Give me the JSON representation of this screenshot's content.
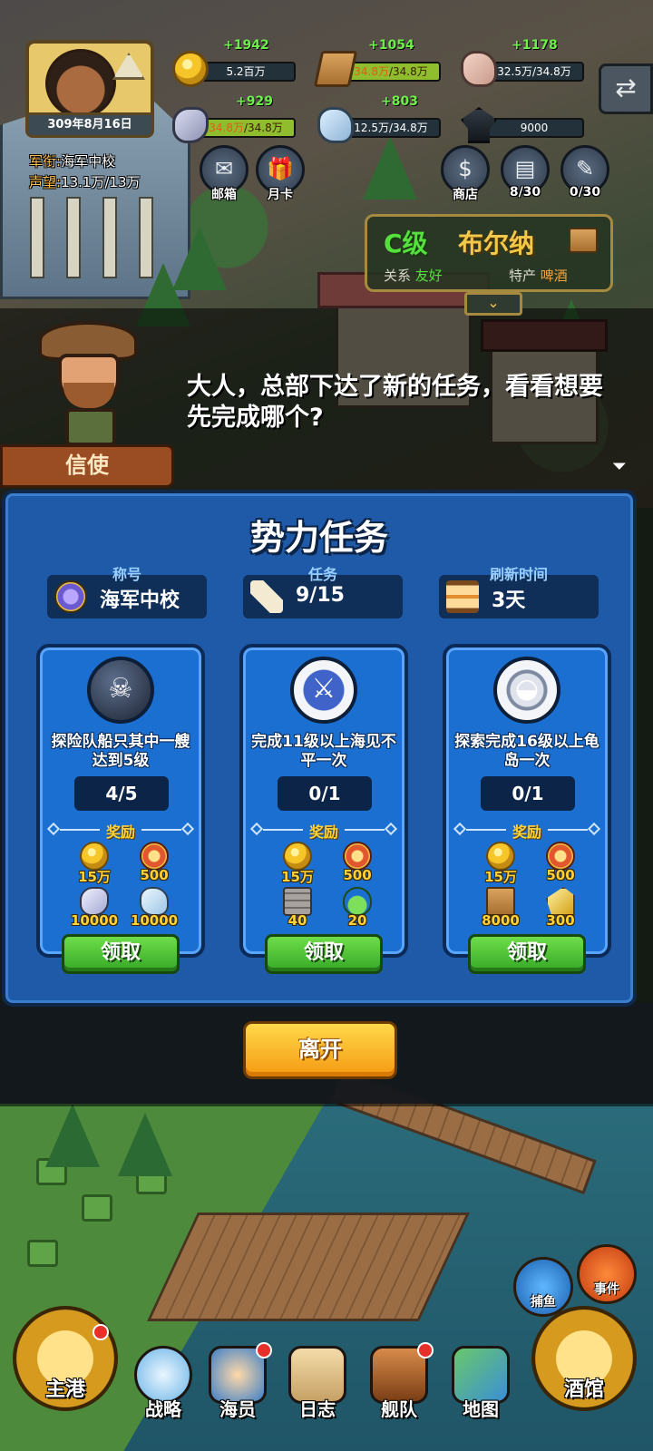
{
  "player": {
    "date": "309年8月16日",
    "rank_key": "军衔:",
    "rank_val": "海军中校",
    "prestige_key": "声望:",
    "prestige_val": "13.1万/13万"
  },
  "resources": [
    {
      "name": "gold",
      "icon": "coin-icon",
      "gain": "+1942",
      "amount": "5.2百万",
      "capped": false
    },
    {
      "name": "wood",
      "icon": "wood-icon",
      "gain": "+1054",
      "amount": "34.8万",
      "cap": "/34.8万",
      "capped": true
    },
    {
      "name": "stone",
      "icon": "stone-icon",
      "gain": "+1178",
      "amount": "32.5万/34.8万",
      "capped": false
    },
    {
      "name": "iron",
      "icon": "iron-ore-icon",
      "gain": "+929",
      "amount": "34.8万",
      "cap": "/34.8万",
      "capped": true
    },
    {
      "name": "crystal",
      "icon": "crystal-icon",
      "gain": "+803",
      "amount": "12.5万/34.8万",
      "capped": false
    },
    {
      "name": "knowledge",
      "icon": "graduation-cap-icon",
      "gain": "",
      "amount": "9000",
      "capped": false
    }
  ],
  "hud_buttons": {
    "mail": "邮箱",
    "monthly_card": "月卡",
    "shop": "商店",
    "book": "8/30",
    "scroll": "0/30"
  },
  "town": {
    "grade": "C级",
    "name": "布尔纳",
    "relation_key": "关系",
    "relation_val": "友好",
    "product_key": "特产",
    "product_val": "啤酒"
  },
  "dialogue": {
    "speaker": "信使",
    "text": "大人，总部下达了新的任务，看看想要先完成哪个?"
  },
  "panel": {
    "title": "势力任务",
    "info": [
      {
        "caption": "称号",
        "value": "海军中校",
        "icon": "rank-medal-icon"
      },
      {
        "caption": "任务",
        "value": "9/15",
        "icon": "scroll-icon"
      },
      {
        "caption": "刷新时间",
        "value": "3天",
        "icon": "hourglass-icon"
      }
    ],
    "reward_label": "奖励",
    "claim_label": "领取",
    "tasks": [
      {
        "emblem": "bomb-skull-icon",
        "desc": "探险队船只其中一艘达到5级",
        "progress": "4/5",
        "rewards": [
          {
            "icon": "coin-icon",
            "qty": "15万"
          },
          {
            "icon": "star-medal-icon",
            "qty": "500"
          },
          {
            "icon": "iron-ore-icon",
            "qty": "10000"
          },
          {
            "icon": "crystal-icon",
            "qty": "10000"
          }
        ]
      },
      {
        "emblem": "crossed-swords-icon",
        "desc": "完成11级以上海见不平一次",
        "progress": "0/1",
        "rewards": [
          {
            "icon": "coin-icon",
            "qty": "15万"
          },
          {
            "icon": "star-medal-icon",
            "qty": "500"
          },
          {
            "icon": "cloth-icon",
            "qty": "40"
          },
          {
            "icon": "potion-icon",
            "qty": "20"
          }
        ]
      },
      {
        "emblem": "turtle-island-icon",
        "desc": "探索完成16级以上龟岛一次",
        "progress": "0/1",
        "rewards": [
          {
            "icon": "coin-icon",
            "qty": "15万"
          },
          {
            "icon": "star-medal-icon",
            "qty": "500"
          },
          {
            "icon": "wood-icon",
            "qty": "8000"
          },
          {
            "icon": "gold-ore-icon",
            "qty": "300"
          }
        ]
      }
    ]
  },
  "leave_label": "离开",
  "side_buttons": {
    "fishing": "捕鱼",
    "event": "事件"
  },
  "nav": {
    "main_port": "主港",
    "strategy": "战略",
    "crew": "海员",
    "log": "日志",
    "fleet": "舰队",
    "map": "地图",
    "tavern": "酒馆"
  }
}
